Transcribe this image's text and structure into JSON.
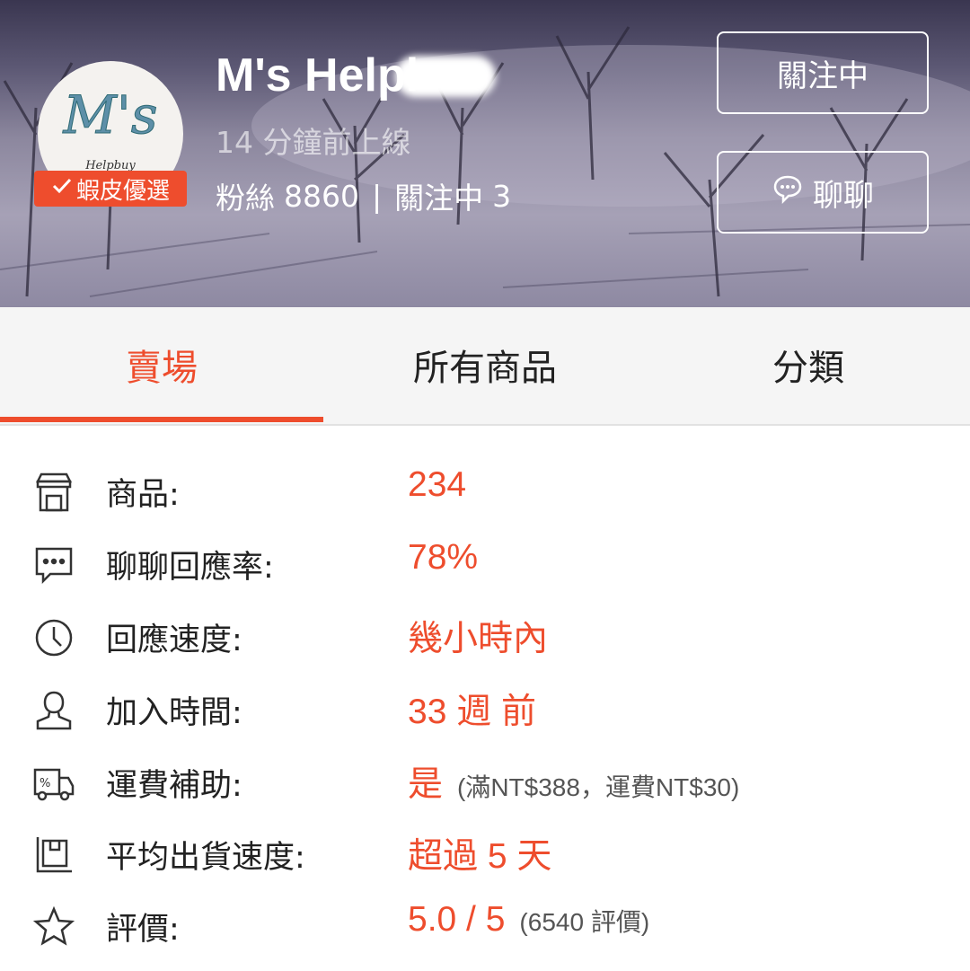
{
  "header": {
    "shop_name": "M's Helpl",
    "online_status": "14 分鐘前上線",
    "followers_label": "粉絲",
    "followers_count": "8860",
    "following_label": "關注中",
    "following_count": "3",
    "preferred_badge": "蝦皮優選",
    "follow_button": "關注中",
    "chat_button": "聊聊",
    "avatar_logo_text": "M's",
    "avatar_sub_text": "Helpbuy"
  },
  "tabs": [
    {
      "label": "賣場",
      "active": true
    },
    {
      "label": "所有商品",
      "active": false
    },
    {
      "label": "分類",
      "active": false
    }
  ],
  "info": [
    {
      "icon": "store-icon",
      "label": "商品:",
      "value": "234",
      "note": ""
    },
    {
      "icon": "chat-bubble-icon",
      "label": "聊聊回應率:",
      "value": "78%",
      "note": ""
    },
    {
      "icon": "clock-icon",
      "label": "回應速度:",
      "value": "幾小時內",
      "note": ""
    },
    {
      "icon": "user-icon",
      "label": "加入時間:",
      "value": "33 週 前",
      "note": ""
    },
    {
      "icon": "shipping-truck-icon",
      "label": "運費補助:",
      "value": "是",
      "note": "(滿NT$388，運費NT$30)"
    },
    {
      "icon": "package-icon",
      "label": "平均出貨速度:",
      "value": "超過 5 天",
      "note": ""
    },
    {
      "icon": "star-icon",
      "label": "評價:",
      "value": "5.0 / 5",
      "note": "(6540 評價)"
    }
  ],
  "colors": {
    "accent": "#ee4d2d",
    "tab_bg": "#f5f5f5",
    "text": "#222222"
  }
}
